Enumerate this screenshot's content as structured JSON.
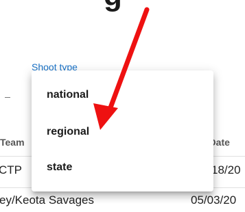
{
  "header": {
    "partial_title": "g"
  },
  "filter": {
    "label": "Shoot type",
    "options": [
      "national",
      "regional",
      "state"
    ]
  },
  "table": {
    "columns": [
      "Team",
      "t Date"
    ],
    "rows": [
      {
        "team": "CTP",
        "date": "18/20"
      },
      {
        "team": "ey/Keota Savages",
        "date": "05/03/20"
      }
    ]
  },
  "annotation": {
    "arrow_color": "#ee1111"
  }
}
